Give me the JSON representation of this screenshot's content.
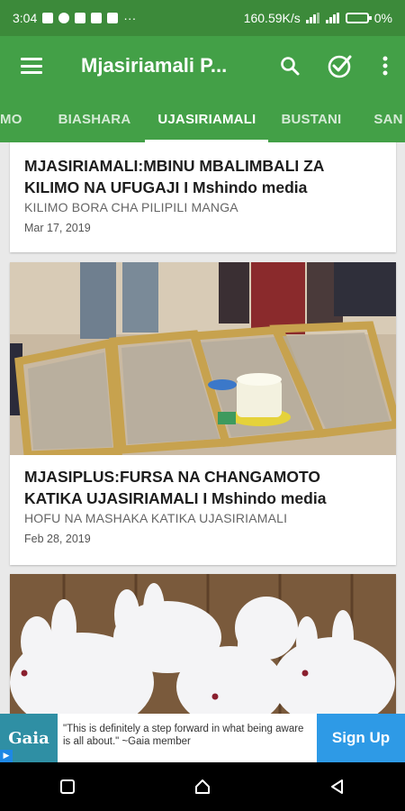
{
  "status_bar": {
    "time": "3:04",
    "more_indicator": "···",
    "network_speed": "160.59K/s",
    "battery_percent": "0%"
  },
  "app_bar": {
    "title": "Mjasiriamali P...",
    "icons": [
      "menu-icon",
      "search-icon",
      "check-circle-icon",
      "more-vert-icon"
    ]
  },
  "tabs": [
    {
      "label": "MO",
      "active": false
    },
    {
      "label": "BIASHARA",
      "active": false
    },
    {
      "label": "UJASIRIAMALI",
      "active": true
    },
    {
      "label": "BUSTANI",
      "active": false
    },
    {
      "label": "SAN",
      "active": false
    }
  ],
  "articles": [
    {
      "title": "MJASIRIAMALI:MBINU MBALIMBALI ZA KILIMO NA UFUGAJI I Mshindo media",
      "subtitle": "KILIMO BORA CHA PILIPILI MANGA",
      "date": "Mar 17, 2019"
    },
    {
      "title": "MJASIPLUS:FURSA NA CHANGAMOTO KATIKA UJASIRIAMALI I Mshindo media",
      "subtitle": "HOFU NA MASHAKA KATIKA UJASIRIAMALI",
      "date": "Feb 28, 2019"
    }
  ],
  "ad": {
    "brand": "Gaia",
    "text": "\"This is definitely a step forward in what being aware is all about.\" ~Gaia member",
    "cta": "Sign Up"
  },
  "colors": {
    "primary": "#43a047",
    "status_bar": "#3c8a3a",
    "ad_button": "#2e9ae6"
  }
}
